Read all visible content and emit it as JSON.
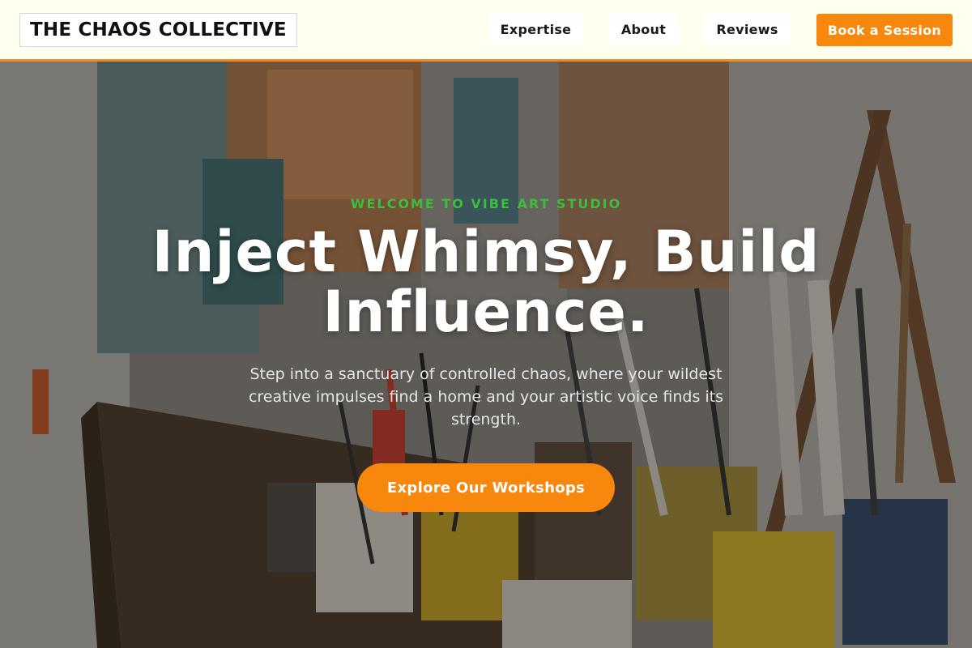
{
  "header": {
    "logo_text": "THE CHAOS COLLECTIVE",
    "nav": {
      "expertise": "Expertise",
      "about": "About",
      "reviews": "Reviews"
    },
    "book_label": "Book a Session"
  },
  "hero": {
    "eyebrow": "WELCOME TO VIBE ART STUDIO",
    "headline_line1": "Inject Whimsy, Build",
    "headline_line2": "Influence.",
    "subtext": "Step into a sanctuary of controlled chaos, where your wildest creative impulses find a home and your artistic voice finds its strength.",
    "cta_label": "Explore Our Workshops"
  },
  "colors": {
    "accent": "#f7870d",
    "eyebrow": "#3dbd3d",
    "header_bg": "#fffff0"
  },
  "icons": [
    "studio-photo-background"
  ]
}
